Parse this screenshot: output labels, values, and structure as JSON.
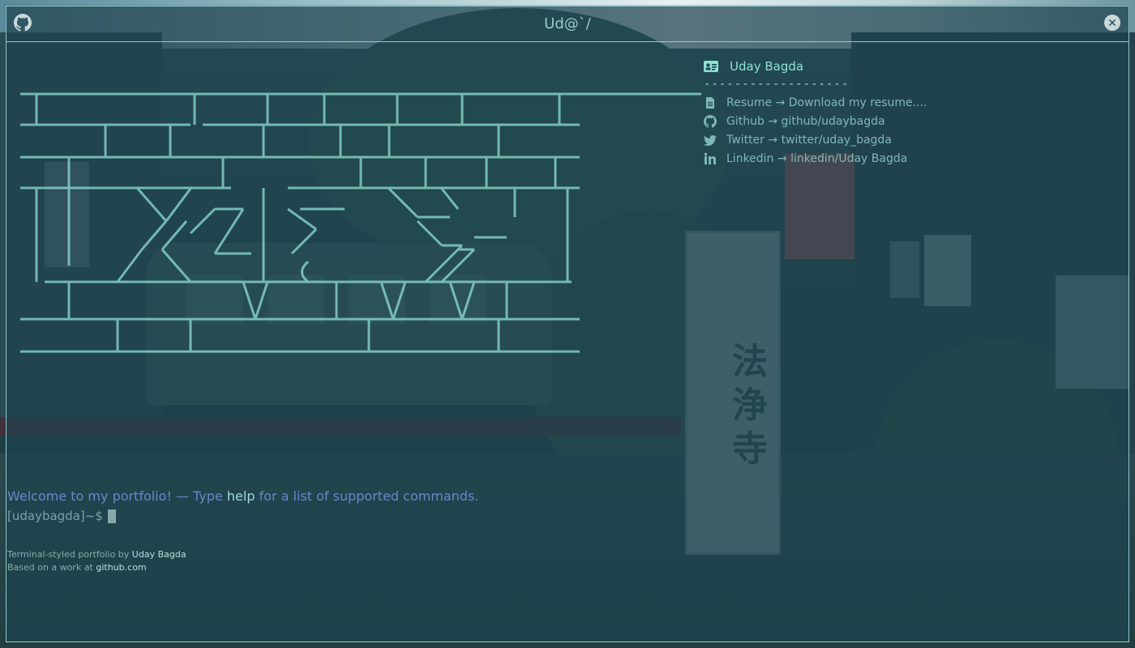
{
  "window": {
    "title": "Ud@`/",
    "close_glyph": "✕"
  },
  "ascii_banner": [
    " ______________________________________________________________________________________",
    " _|__________|________|__________|__________|_______|__________|_______________|_______",
    " ________|_______|_________|________|_________|_________|__________|__________|________",
    " __|__________|_______________|___/_____|___|______|___|____|________|______|__________",
    " |  |    \\  /   |  __   |_  \\___    \\____   \\     |     |",
    " |  |     //  //  _/   |_   /     __    \\    \\__      |",
    " |  |    /  \\ ___/  |___(_______  /  __/  _______   |",
    " ___|________|_________V______|________V______\\/___|________",
    " ________|______|_______|______________________|__________|_________"
  ],
  "profile": {
    "name": "Uday Bagda",
    "divider": "-------------------",
    "links": [
      {
        "icon": "file-icon",
        "label": "Resume",
        "arrow": "→",
        "target": "Download my resume...."
      },
      {
        "icon": "github-icon",
        "label": "Github",
        "arrow": "→",
        "target": "github/udaybagda"
      },
      {
        "icon": "twitter-icon",
        "label": "Twitter",
        "arrow": "→",
        "target": "twitter/uday_bagda"
      },
      {
        "icon": "linkedin-icon",
        "label": "Linkedin",
        "arrow": "→",
        "target": "linkedin/Uday Bagda"
      }
    ]
  },
  "welcome": {
    "before": "Welcome to my portfolio! — Type ",
    "command": "help",
    "after": " for a list of supported commands."
  },
  "prompt": {
    "text": "[udaybagda]~$",
    "value": ""
  },
  "footer": {
    "line1_prefix": "Terminal-styled portfolio by ",
    "line1_link": "Uday Bagda",
    "line2_prefix": "Based on a work at ",
    "line2_link": "github.com"
  },
  "colors": {
    "accent": "#8ee0d4",
    "border": "#8fd0d2",
    "welcome": "#6f84c9",
    "link_text": "#7fb7b8"
  }
}
